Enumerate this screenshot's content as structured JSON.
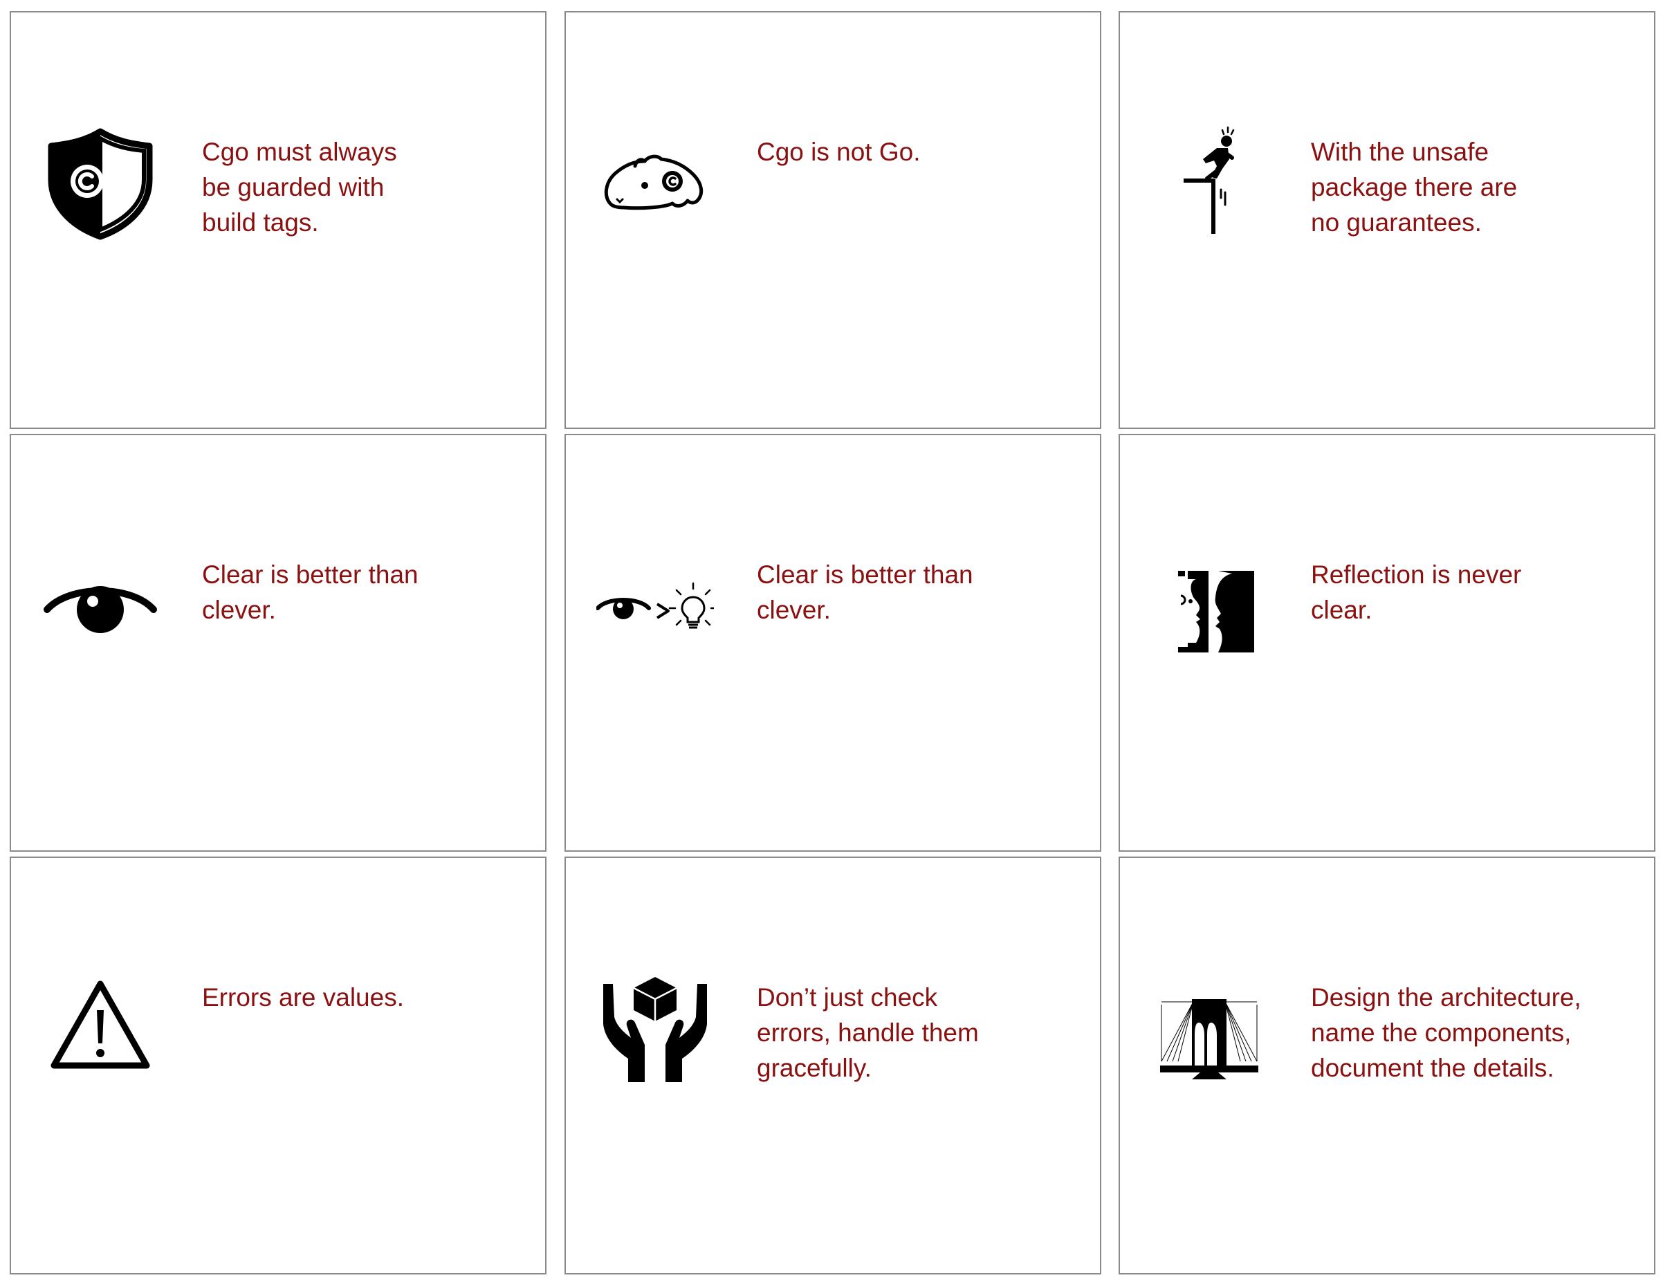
{
  "cards": [
    {
      "icon": "shield-c-icon",
      "text": "Cgo must always\nbe guarded with\nbuild tags."
    },
    {
      "icon": "gopher-c-icon",
      "text": "Cgo is not Go."
    },
    {
      "icon": "cliff-edge-icon",
      "text": "With the unsafe\npackage there are\nno guarantees."
    },
    {
      "icon": "eye-icon",
      "text": "Clear is better than\nclever."
    },
    {
      "icon": "eye-greater-than-lightbulb-icon",
      "text": "Clear is better than\nclever."
    },
    {
      "icon": "two-faces-icon",
      "text": "Reflection is never\nclear."
    },
    {
      "icon": "warning-triangle-icon",
      "text": "Errors are values."
    },
    {
      "icon": "hands-holding-box-icon",
      "text": "Don’t just check\nerrors, handle them\ngracefully."
    },
    {
      "icon": "bridge-icon",
      "text": "Design the architecture,\nname the components,\ndocument the details."
    }
  ],
  "colors": {
    "text": "#8b1010",
    "border": "#8a8a8a",
    "icon": "#000000",
    "background": "#ffffff"
  }
}
